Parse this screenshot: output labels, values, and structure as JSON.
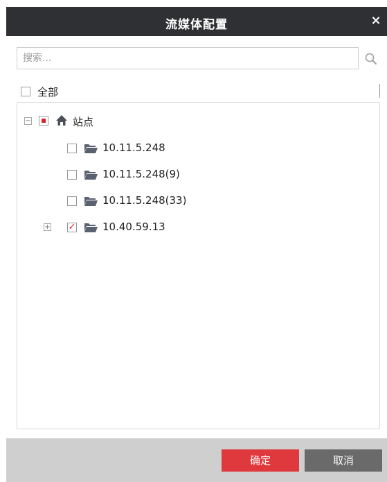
{
  "dialog": {
    "title": "流媒体配置",
    "close_symbol": "×"
  },
  "search": {
    "placeholder": "搜索...",
    "value": "",
    "icon": "search-icon"
  },
  "select_all": {
    "label": "全部",
    "checked": false
  },
  "tree": {
    "root": {
      "label": "站点",
      "icon": "home-icon",
      "expanded": true,
      "state": "partial"
    },
    "children": [
      {
        "label": "10.11.5.248",
        "icon": "folder-icon",
        "state": "unchecked",
        "expandable": false
      },
      {
        "label": "10.11.5.248(9)",
        "icon": "folder-icon",
        "state": "unchecked",
        "expandable": false
      },
      {
        "label": "10.11.5.248(33)",
        "icon": "folder-icon",
        "state": "unchecked",
        "expandable": false
      },
      {
        "label": "10.40.59.13",
        "icon": "folder-icon",
        "state": "checked",
        "expandable": true
      }
    ]
  },
  "footer": {
    "ok_label": "确定",
    "cancel_label": "取消"
  },
  "colors": {
    "titlebar": "#2f3033",
    "accent_red": "#e0393d",
    "cancel_gray": "#6a6a6a",
    "footer_bg": "#cfcfcf"
  }
}
